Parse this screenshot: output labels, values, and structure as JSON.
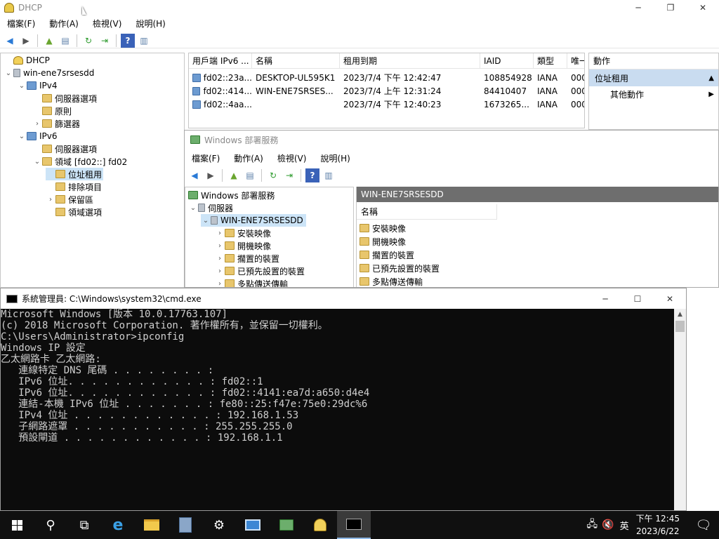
{
  "dhcp": {
    "title": "DHCP",
    "menu": [
      "檔案(F)",
      "動作(A)",
      "檢視(V)",
      "說明(H)"
    ],
    "tree": [
      {
        "label": "DHCP",
        "icon": "dhcp-icon",
        "depth": 0,
        "chevron": ""
      },
      {
        "label": "win-ene7srsesdd",
        "icon": "server-icon",
        "depth": 1,
        "chevron": "⌄"
      },
      {
        "label": "IPv4",
        "icon": "network-icon",
        "depth": 2,
        "chevron": "⌄"
      },
      {
        "label": "伺服器選項",
        "icon": "folder-icon",
        "depth": 3,
        "chevron": ""
      },
      {
        "label": "原則",
        "icon": "folder-icon",
        "depth": 3,
        "chevron": ""
      },
      {
        "label": "篩選器",
        "icon": "filter-icon",
        "depth": 3,
        "chevron": "›"
      },
      {
        "label": "IPv6",
        "icon": "network-icon",
        "depth": 2,
        "chevron": "⌄"
      },
      {
        "label": "伺服器選項",
        "icon": "folder-icon",
        "depth": 3,
        "chevron": ""
      },
      {
        "label": "領域 [fd02::] fd02",
        "icon": "folder-icon",
        "depth": 3,
        "chevron": "⌄"
      },
      {
        "label": "位址租用",
        "icon": "folder-icon",
        "depth": 4,
        "chevron": "",
        "selected": true
      },
      {
        "label": "排除項目",
        "icon": "folder-icon",
        "depth": 4,
        "chevron": ""
      },
      {
        "label": "保留區",
        "icon": "folder-icon",
        "depth": 4,
        "chevron": "›"
      },
      {
        "label": "領域選項",
        "icon": "folder-icon",
        "depth": 4,
        "chevron": ""
      }
    ],
    "columns": [
      "用戶端 IPv6 ...",
      "名稱",
      "租用到期",
      "IAID",
      "類型",
      "唯一"
    ],
    "rows": [
      [
        "fd02::23a...",
        "DESKTOP-UL595K1",
        "2023/7/4 下午 12:42:47",
        "108854928",
        "IANA",
        "000"
      ],
      [
        "fd02::414...",
        "WIN-ENE7SRSES...",
        "2023/7/4 上午 12:31:24",
        "84410407",
        "IANA",
        "000"
      ],
      [
        "fd02::4aa...",
        "",
        "2023/7/4 下午 12:40:23",
        "1673265...",
        "IANA",
        "000"
      ]
    ],
    "actions": {
      "header": "動作",
      "section": "位址租用",
      "more": "其他動作"
    }
  },
  "wds": {
    "title": "Windows 部署服務",
    "menu": [
      "檔案(F)",
      "動作(A)",
      "檢視(V)",
      "說明(H)"
    ],
    "tree": [
      {
        "label": "Windows 部署服務",
        "icon": "wds-icon",
        "depth": 0,
        "chevron": ""
      },
      {
        "label": "伺服器",
        "icon": "servers-icon",
        "depth": 1,
        "chevron": "⌄"
      },
      {
        "label": "WIN-ENE7SRSESDD",
        "icon": "server-icon",
        "depth": 2,
        "chevron": "⌄",
        "selected": true
      },
      {
        "label": "安裝映像",
        "icon": "folder-icon",
        "depth": 3,
        "chevron": "›"
      },
      {
        "label": "開機映像",
        "icon": "folder-icon",
        "depth": 3,
        "chevron": "›"
      },
      {
        "label": "擱置的裝置",
        "icon": "folder-icon",
        "depth": 3,
        "chevron": "›"
      },
      {
        "label": "已預先設置的裝置",
        "icon": "folder-icon",
        "depth": 3,
        "chevron": "›"
      },
      {
        "label": "多點傳送傳輸",
        "icon": "folder-icon",
        "depth": 3,
        "chevron": "›"
      }
    ],
    "panel_title": "WIN-ENE7SRSESDD",
    "list_header": "名稱",
    "list": [
      "安裝映像",
      "開機映像",
      "擱置的裝置",
      "已預先設置的裝置",
      "多點傳送傳輸"
    ]
  },
  "cmd": {
    "title": "系統管理員: C:\\Windows\\system32\\cmd.exe",
    "lines": [
      "Microsoft Windows [版本 10.0.17763.107]",
      "(c) 2018 Microsoft Corporation. 著作權所有，並保留一切權利。",
      "",
      "C:\\Users\\Administrator>ipconfig",
      "",
      "Windows IP 設定",
      "",
      "",
      "乙太網路卡 乙太網路:",
      "",
      "   連線特定 DNS 尾碼 . . . . . . . . :",
      "   IPv6 位址. . . . . . . . . . . . : fd02::1",
      "   IPv6 位址. . . . . . . . . . . . : fd02::4141:ea7d:a650:d4e4",
      "   連結-本機 IPv6 位址 . . . . . . . : fe80::25:f47e:75e0:29dc%6",
      "   IPv4 位址 . . . . . . . . . . . . : 192.168.1.53",
      "   子網路遮罩 . . . . . . . . . . . : 255.255.255.0",
      "   預設閘道 . . . . . . . . . . . . : 192.168.1.1"
    ]
  },
  "taskbar": {
    "ime": "英",
    "time": "下午 12:45",
    "date": "2023/6/22"
  }
}
